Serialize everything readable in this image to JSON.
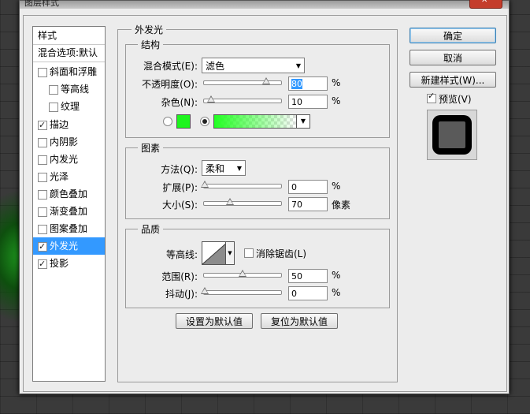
{
  "window": {
    "title": "图层样式"
  },
  "styles_list": {
    "header": "样式",
    "blend_options": "混合选项:默认",
    "items": [
      {
        "label": "斜面和浮雕",
        "checked": false
      },
      {
        "label": "等高线",
        "checked": false
      },
      {
        "label": "纹理",
        "checked": false
      },
      {
        "label": "描边",
        "checked": true
      },
      {
        "label": "内阴影",
        "checked": false
      },
      {
        "label": "内发光",
        "checked": false
      },
      {
        "label": "光泽",
        "checked": false
      },
      {
        "label": "颜色叠加",
        "checked": false
      },
      {
        "label": "渐变叠加",
        "checked": false
      },
      {
        "label": "图案叠加",
        "checked": false
      },
      {
        "label": "外发光",
        "checked": true,
        "selected": true
      },
      {
        "label": "投影",
        "checked": true
      }
    ]
  },
  "outer_glow": {
    "title": "外发光",
    "structure": {
      "title": "结构",
      "blend_mode_label": "混合模式(E):",
      "blend_mode_value": "滤色",
      "opacity_label": "不透明度(O):",
      "opacity_value": "80",
      "noise_label": "杂色(N):",
      "noise_value": "10",
      "percent": "%",
      "color_swatch": "#1ef51e"
    },
    "elements": {
      "title": "图素",
      "technique_label": "方法(Q):",
      "technique_value": "柔和",
      "spread_label": "扩展(P):",
      "spread_value": "0",
      "size_label": "大小(S):",
      "size_value": "70",
      "size_unit": "像素",
      "percent": "%"
    },
    "quality": {
      "title": "品质",
      "contour_label": "等高线:",
      "antialias_label": "消除锯齿(L)",
      "range_label": "范围(R):",
      "range_value": "50",
      "jitter_label": "抖动(J):",
      "jitter_value": "0",
      "percent": "%"
    },
    "make_default": "设置为默认值",
    "reset_default": "复位为默认值"
  },
  "buttons": {
    "ok": "确定",
    "cancel": "取消",
    "new_style": "新建样式(W)...",
    "preview_label": "预览(V)",
    "preview_checked": true
  }
}
